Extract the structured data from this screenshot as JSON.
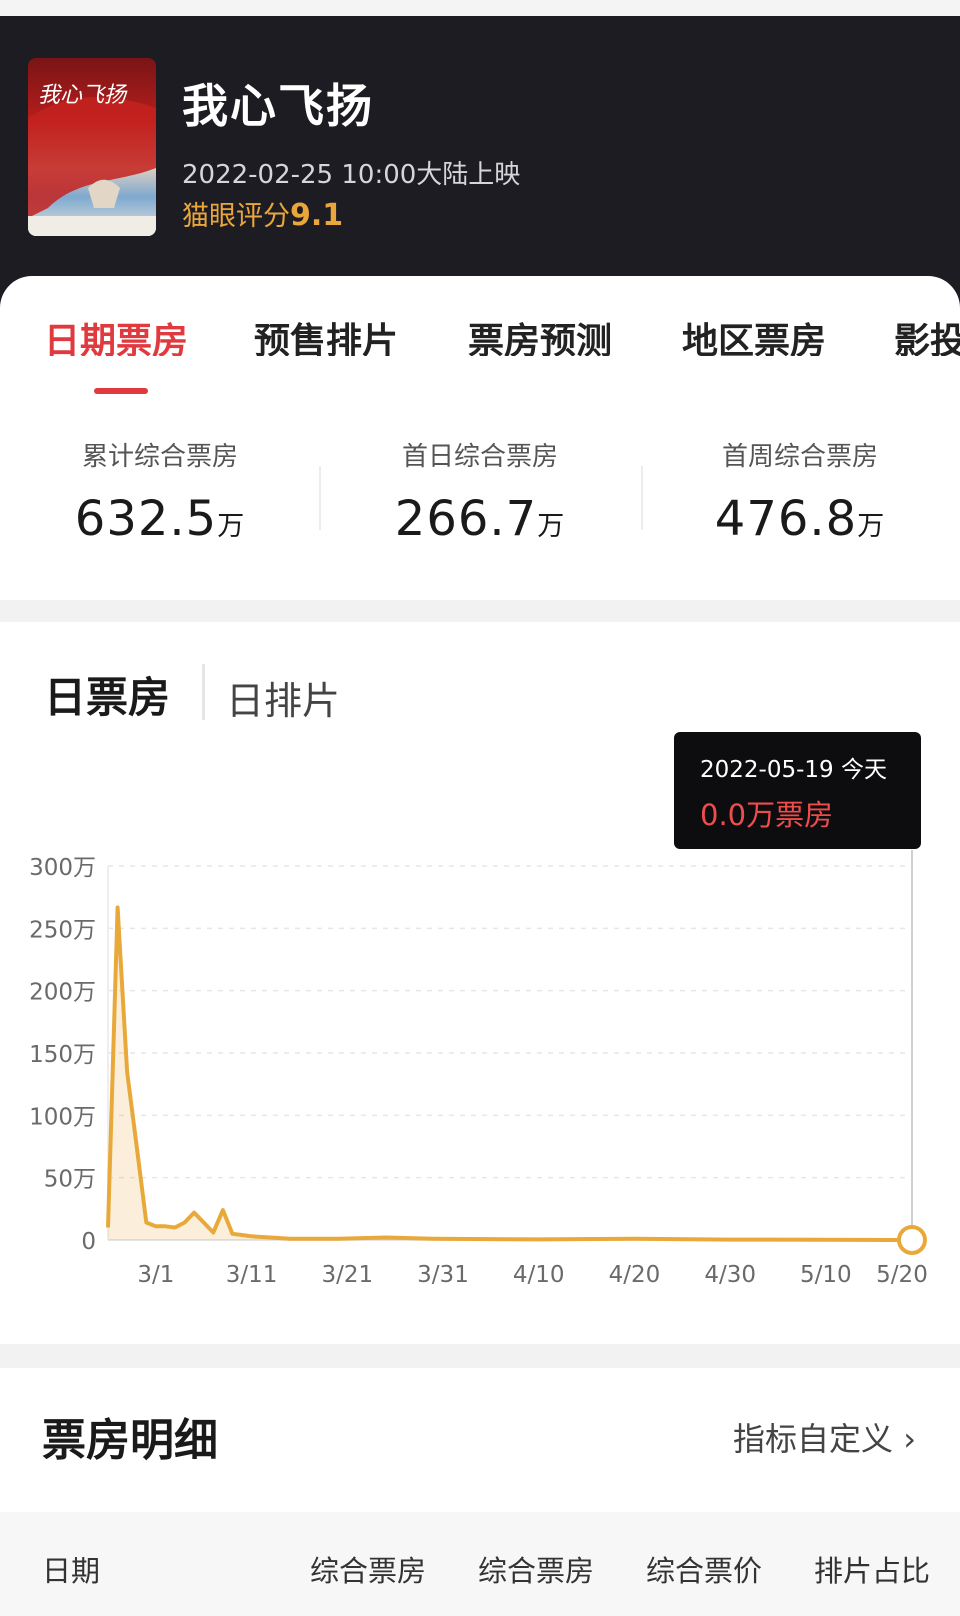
{
  "header": {
    "title": "我心飞扬",
    "release": "2022-02-25 10:00大陆上映",
    "rating_label": "猫眼评分",
    "rating_score": "9.1"
  },
  "tabs": [
    {
      "label": "日期票房",
      "active": true
    },
    {
      "label": "预售排片",
      "active": false
    },
    {
      "label": "票房预测",
      "active": false
    },
    {
      "label": "地区票房",
      "active": false
    },
    {
      "label": "影投",
      "active": false
    }
  ],
  "stats": [
    {
      "label": "累计综合票房",
      "value": "632.5",
      "unit": "万"
    },
    {
      "label": "首日综合票房",
      "value": "266.7",
      "unit": "万"
    },
    {
      "label": "首周综合票房",
      "value": "476.8",
      "unit": "万"
    }
  ],
  "chart_section": {
    "tab_daily_box": "日票房",
    "tab_daily_schedule": "日排片",
    "tooltip_date": "2022-05-19 今天",
    "tooltip_value": "0.0万票房"
  },
  "chart_data": {
    "type": "area",
    "y_ticks": [
      "300万",
      "250万",
      "200万",
      "150万",
      "100万",
      "50万",
      "0"
    ],
    "x_ticks": [
      "3/1",
      "3/11",
      "3/21",
      "3/31",
      "4/10",
      "4/20",
      "4/30",
      "5/10",
      "5/20"
    ],
    "ylim": [
      0,
      300
    ],
    "yunit": "万",
    "grid": true,
    "series": [
      {
        "color": "#e8a93a",
        "points": [
          [
            "2022-02-24",
            10
          ],
          [
            "2022-02-25",
            266.7
          ],
          [
            "2022-02-26",
            135
          ],
          [
            "2022-02-27",
            75
          ],
          [
            "2022-02-28",
            14
          ],
          [
            "2022-03-01",
            11
          ],
          [
            "2022-03-02",
            11
          ],
          [
            "2022-03-03",
            10
          ],
          [
            "2022-03-04",
            14
          ],
          [
            "2022-03-05",
            22
          ],
          [
            "2022-03-06",
            14
          ],
          [
            "2022-03-07",
            6
          ],
          [
            "2022-03-08",
            24
          ],
          [
            "2022-03-09",
            5
          ],
          [
            "2022-03-10",
            4
          ],
          [
            "2022-03-11",
            3
          ],
          [
            "2022-03-13",
            2
          ],
          [
            "2022-03-15",
            1
          ],
          [
            "2022-03-20",
            1
          ],
          [
            "2022-03-25",
            2
          ],
          [
            "2022-03-30",
            1
          ],
          [
            "2022-04-10",
            0.5
          ],
          [
            "2022-04-20",
            1
          ],
          [
            "2022-04-30",
            0.3
          ],
          [
            "2022-05-10",
            0.2
          ],
          [
            "2022-05-19",
            0
          ]
        ]
      }
    ],
    "highlight_point": [
      "2022-05-19",
      0
    ]
  },
  "detail": {
    "title": "票房明细",
    "custom_link": "指标自定义",
    "columns": [
      "日期",
      "综合票房",
      "综合票房",
      "综合票价",
      "排片占比"
    ]
  },
  "colors": {
    "accent": "#e0393e",
    "rating": "#e9a63b",
    "chart_line": "#e8a93a",
    "header_bg": "#1d1c22"
  }
}
